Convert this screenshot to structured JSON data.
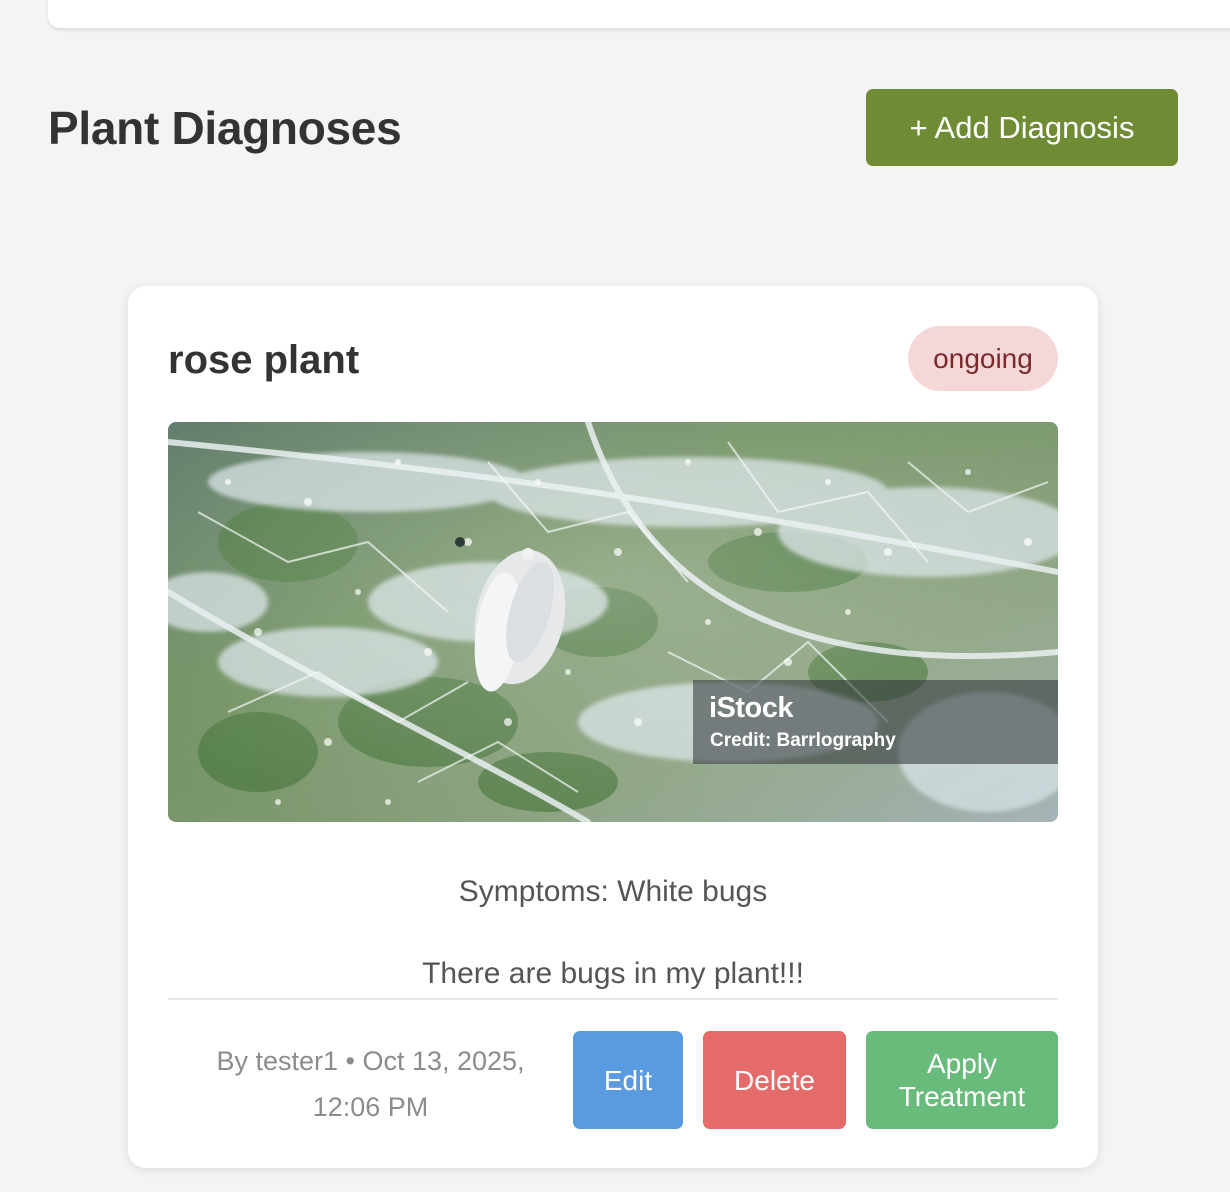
{
  "header": {
    "title": "Plant Diagnoses",
    "add_button_label": "+ Add Diagnosis"
  },
  "diagnosis": {
    "plant_name": "rose plant",
    "status": "ongoing",
    "image": {
      "watermark_logo": "iStock",
      "watermark_credit": "Credit: Barrlography"
    },
    "symptoms": "Symptoms: White bugs",
    "description": "There are bugs in my plant!!!",
    "meta_line1": "By tester1 • Oct 13, 2025,",
    "meta_line2": "12:06 PM",
    "actions": {
      "edit_label": "Edit",
      "delete_label": "Delete",
      "apply_line1": "Apply",
      "apply_line2": "Treatment"
    }
  },
  "colors": {
    "background": "#f4f4f4",
    "add_button": "#6f8c34",
    "status_badge_bg": "#f6d7d7",
    "status_badge_text": "#7a2a2a",
    "edit_button": "#5a9ae0",
    "delete_button": "#e56b6b",
    "apply_button": "#69bb7c"
  }
}
